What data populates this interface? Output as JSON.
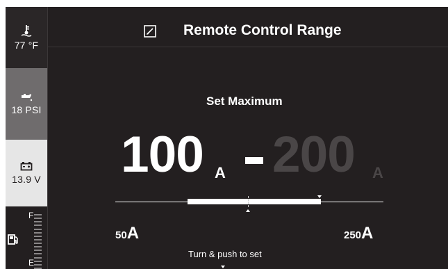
{
  "sidebar": {
    "temperature": {
      "value": "77 °F",
      "icon": "water-temperature-icon"
    },
    "oil_pressure": {
      "value": "18 PSI",
      "icon": "oil-pressure-icon"
    },
    "battery": {
      "value": "13.9 V",
      "icon": "battery-icon"
    },
    "fuel": {
      "full_label": "F",
      "empty_label": "E",
      "icon": "fuel-pump-icon",
      "level": 0.0
    }
  },
  "header": {
    "title": "Remote Control Range",
    "icon": "edit-icon"
  },
  "main": {
    "subtitle": "Set Maximum",
    "min_value": "100",
    "min_unit": "A",
    "separator": "-",
    "max_value": "200",
    "max_unit": "A",
    "range_low_num": "50",
    "range_low_unit": "A",
    "range_high_num": "250",
    "range_high_unit": "A",
    "hint": "Turn & push to set"
  },
  "colors": {
    "background": "#231f20",
    "active_text": "#ffffff",
    "inactive_text": "#4a4647",
    "psi_panel": "#6f6c6d",
    "volt_panel": "#e6e6e6"
  }
}
